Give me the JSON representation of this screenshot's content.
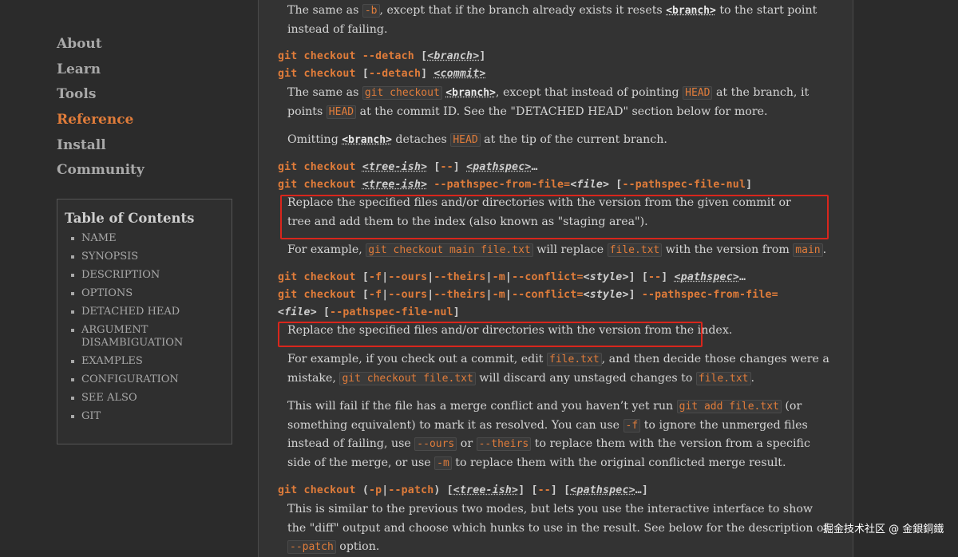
{
  "nav": [
    {
      "label": "About",
      "active": false
    },
    {
      "label": "Learn",
      "active": false
    },
    {
      "label": "Tools",
      "active": false
    },
    {
      "label": "Reference",
      "active": true
    },
    {
      "label": "Install",
      "active": false
    },
    {
      "label": "Community",
      "active": false
    }
  ],
  "toc": {
    "title": "Table of Contents",
    "items": [
      "NAME",
      "SYNOPSIS",
      "DESCRIPTION",
      "OPTIONS",
      "DETACHED HEAD",
      "ARGUMENT DISAMBIGUATION",
      "EXAMPLES",
      "CONFIGURATION",
      "SEE ALSO",
      "GIT"
    ]
  },
  "p0": {
    "t1": "The same as ",
    "c1": "-b",
    "t2": ", except that if the branch already exists it resets ",
    "ph1": "<branch>",
    "t3": " to the start point instead of failing."
  },
  "sig1": {
    "cmd": "git checkout --detach ",
    "b1": "[",
    "ph": "<branch>",
    "b2": "]"
  },
  "sig2": {
    "cmd": "git checkout ",
    "b1": "[",
    "opt": "--detach",
    "b2": "] ",
    "ph": "<commit>"
  },
  "p1": {
    "t1": "The same as ",
    "c1": "git checkout",
    "t2": " ",
    "ph1": "<branch>",
    "t3": ", except that instead of pointing ",
    "c2": "HEAD",
    "t4": " at the branch, it points ",
    "c3": "HEAD",
    "t5": " at the commit ID. See the \"DETACHED HEAD\" section below for more."
  },
  "p2": {
    "t1": "Omitting ",
    "ph1": "<branch>",
    "t2": " detaches ",
    "c1": "HEAD",
    "t3": " at the tip of the current branch."
  },
  "sig3": {
    "cmd": "git checkout ",
    "ph1": "<tree-ish>",
    "t1": " [",
    "opt": "--",
    "t2": "] ",
    "ph2": "<pathspec>",
    "t3": "…"
  },
  "sig4": {
    "cmd": "git checkout ",
    "ph1": "<tree-ish>",
    "t1": " --pathspec-from-file=",
    "ph2": "<file>",
    "t2": " [",
    "opt": "--pathspec-file-nul",
    "t3": "]"
  },
  "p3": "Replace the specified files and/or directories with the version from the given commit or tree and add them to the index (also known as \"staging area\").",
  "p4": {
    "t1": "For example, ",
    "c1": "git checkout main file.txt",
    "t2": " will replace ",
    "c2": "file.txt",
    "t3": " with the version from ",
    "c3": "main",
    "t4": "."
  },
  "sig5": {
    "cmd": "git checkout ",
    "t1": "[",
    "o1": "-f",
    "s1": "|",
    "o2": "--ours",
    "s2": "|",
    "o3": "--theirs",
    "s3": "|",
    "o4": "-m",
    "s4": "|",
    "o5": "--conflict=",
    "ph1": "<style>",
    "t2": "] [",
    "o6": "--",
    "t3": "] ",
    "ph2": "<pathspec>",
    "t4": "…"
  },
  "sig6": {
    "cmd": "git checkout ",
    "t1": "[",
    "o1": "-f",
    "s1": "|",
    "o2": "--ours",
    "s2": "|",
    "o3": "--theirs",
    "s3": "|",
    "o4": "-m",
    "s4": "|",
    "o5": "--conflict=",
    "ph1": "<style>",
    "t2": "] ",
    "o6": "--pathspec-from-file="
  },
  "sig6b": {
    "ph1": "<file>",
    "t1": " [",
    "opt": "--pathspec-file-nul",
    "t2": "]"
  },
  "p5": "Replace the specified files and/or directories with the version from the index.",
  "p6": {
    "t1": "For example, if you check out a commit, edit ",
    "c1": "file.txt",
    "t2": ", and then decide those changes were a mistake, ",
    "c2": "git checkout file.txt",
    "t3": " will discard any unstaged changes to ",
    "c3": "file.txt",
    "t4": "."
  },
  "p7": {
    "t1": "This will fail if the file has a merge conflict and you haven’t yet run ",
    "c1": "git add file.txt",
    "t2": " (or something equivalent) to mark it as resolved. You can use ",
    "c2": "-f",
    "t3": " to ignore the unmerged files instead of failing, use ",
    "c3": "--ours",
    "t4": " or ",
    "c4": "--theirs",
    "t5": " to replace them with the version from a specific side of the merge, or use ",
    "c5": "-m",
    "t6": " to replace them with the original conflicted merge result."
  },
  "sig7": {
    "cmd": "git checkout ",
    "t1": "(",
    "o1": "-p",
    "s1": "|",
    "o2": "--patch",
    "t2": ") [",
    "ph1": "<tree-ish>",
    "t3": "] [",
    "o3": "--",
    "t4": "] [",
    "ph2": "<pathspec>",
    "t5": "…]"
  },
  "p8": {
    "t1": "This is similar to the previous two modes, but lets you use the interactive interface to show the \"diff\" output and choose which hunks to use in the result. See below for the description of ",
    "c1": "--patch",
    "t2": " option."
  },
  "watermark": "掘金技术社区 @ 金銀銅鐵",
  "colors": {
    "accent": "#e07c3a",
    "highlight_box": "#d9261c",
    "background": "#2b2b2b",
    "panel": "#333333"
  }
}
